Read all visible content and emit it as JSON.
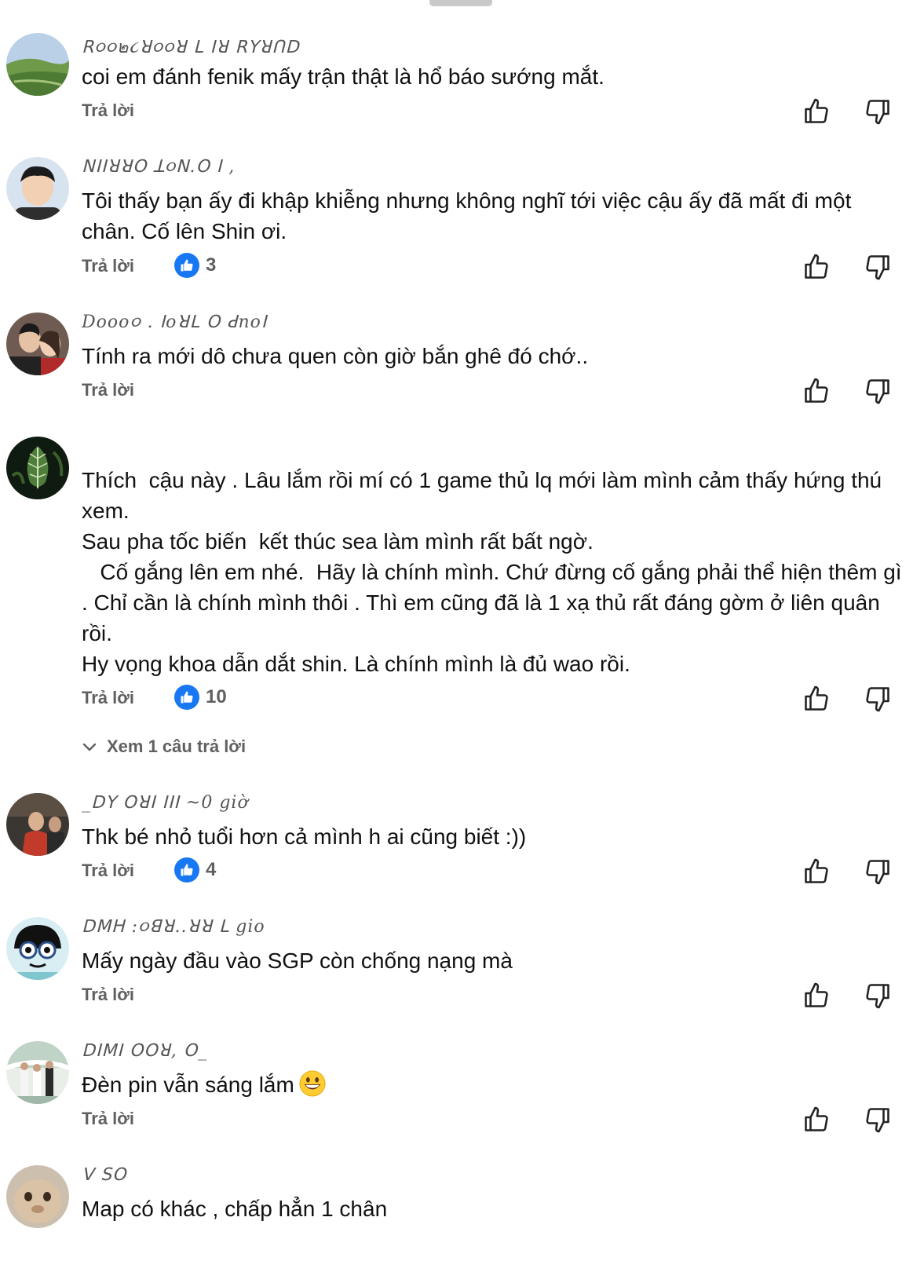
{
  "reply_label": "Trả lời",
  "comments": [
    {
      "author": "ꓣ૦૦๒૮ꓤ૦૦ꓤ ꓡ ꓲꓤ ꓣꓬꓤꓵꓓ",
      "text": "coi em đánh fenik mấy trận thật là hổ báo sướng mắt.",
      "likes": ""
    },
    {
      "author": "ꓠꓲꓲꓤꓤꓳ ꓕ૦ꓠ.ꓳ   ꓲ ,",
      "text": "Tôi thấy bạn ấy đi khập khiễng nhưng không nghĩ tới việc cậu ấy đã mất đi một chân. Cố lên Shin ơi.",
      "likes": "3"
    },
    {
      "author": "Dooo૦ . ꓲoꓤꓡ     ꓳ ꓒnoꓲ",
      "text": "Tính ra mới dô chưa quen còn giờ bắn ghê đó chớ..",
      "likes": ""
    },
    {
      "author": "",
      "text": "Thích  cậu này . Lâu lắm rồi mí có 1 game thủ lq mới làm mình cảm thấy hứng thú xem.\nSau pha tốc biến  kết thúc sea làm mình rất bất ngờ.\n   Cố gắng lên em nhé.  Hãy là chính mình. Chứ đừng cố gắng phải thể hiện thêm gì . Chỉ cần là chính mình thôi . Thì em cũng đã là 1 xạ thủ rất đáng gờm ở liên quân rồi.\nHy vọng khoa dẫn dắt shin. Là chính mình là đủ wao rồi.",
      "likes": "10"
    },
    {
      "author": "_ꓓꓬ  ꓳꓤꓲ  ꓲꓲꓲ ~0 giờ",
      "text": "Thk bé nhỏ tuổi hơn cả mình h ai cũng biết :))",
      "likes": "4"
    },
    {
      "author": "ꓓꓟꓧ :૦ꓭꓤ..ꓤꓤ  ꓡ gio",
      "text": "Mấy ngày đầu vào SGP còn chống nạng mà",
      "likes": ""
    },
    {
      "author": "ꓓꓲꓟꓲ ꓳꓳꓤ, ꓳ_",
      "text": "Đèn pin vẫn sáng lắm",
      "likes": ""
    },
    {
      "author": "ꓦ ꓢꓳ",
      "text": "Map có khác , chấp hẳn 1 chân",
      "likes": ""
    }
  ],
  "view_replies": "Xem 1 câu trả lời",
  "icons": {
    "like": "thumb-up-icon",
    "dislike": "thumb-down-icon",
    "expand": "chevron-down-icon",
    "badge": "like-badge-icon",
    "emoji": "grinning-face-emoji"
  },
  "colors": {
    "accent": "#1877f2",
    "muted": "#606060",
    "text": "#111111"
  }
}
